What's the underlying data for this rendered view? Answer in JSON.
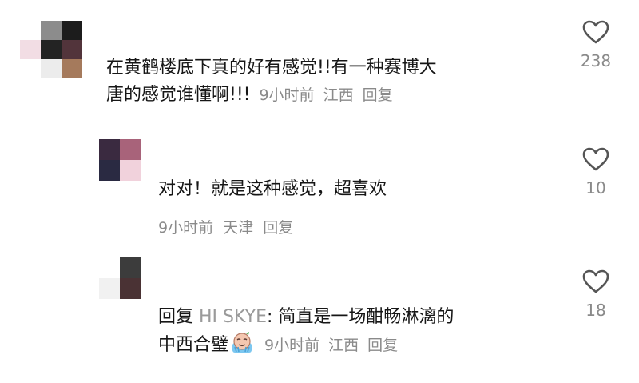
{
  "comments": [
    {
      "text": "在黄鹤楼底下真的好有感觉!!有一种赛博大",
      "text_line2": "唐的感觉谁懂啊!!!",
      "time": "9小时前",
      "location": "江西",
      "reply_label": "回复",
      "likes": "238",
      "avatar_colors": [
        "#ffffff",
        "#8c8c8c",
        "#1c1c1c",
        "#f2dde4",
        "#232323",
        "#52343b",
        "#ffffff",
        "#ececec",
        "#a57a5c"
      ]
    },
    {
      "text": "对对！就是这种感觉，超喜欢",
      "time": "9小时前",
      "location": "天津",
      "reply_label": "回复",
      "likes": "10",
      "avatar_colors": [
        "#3a2a40",
        "#a8637a",
        "#2a2a42",
        "#f1d2dc"
      ]
    },
    {
      "reply_prefix": "回复",
      "reply_to": "HI SKYE",
      "text": ": 简直是一场酣畅淋漓的",
      "text_line2": "中西合璧",
      "time": "9小时前",
      "location": "江西",
      "reply_label": "回复",
      "likes": "18",
      "avatar_colors": [
        "#ffffff",
        "#3c3c3c",
        "#f1f1f1",
        "#4a3234"
      ]
    }
  ],
  "icons": {
    "like": "heart-outline-icon",
    "emoji": "crying-sweat-emoji-icon"
  }
}
